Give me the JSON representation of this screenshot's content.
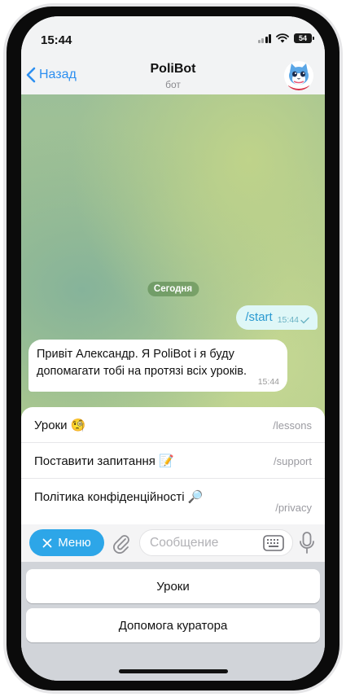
{
  "status_bar": {
    "time": "15:44",
    "battery": "54",
    "icons": [
      "signal-icon",
      "wifi-icon",
      "battery-icon"
    ]
  },
  "header": {
    "back_label": "Назад",
    "title": "PoliBot",
    "subtitle": "бот",
    "avatar_icon": "cat-avatar-icon"
  },
  "chat": {
    "date_chip": "Сегодня",
    "messages": [
      {
        "direction": "out",
        "text": "/start",
        "time": "15:44",
        "status": "read-check-icon"
      },
      {
        "direction": "in",
        "text": "Привіт  Александр. Я PoliBot і я буду допомагати тобі на протязі всіх уроків.",
        "time": "15:44"
      }
    ]
  },
  "commands": [
    {
      "name": "Уроки 🧐",
      "path": "/lessons"
    },
    {
      "name": "Поставити запитання 📝",
      "path": "/support"
    },
    {
      "name": "Політика конфіденційності 🔎",
      "path": "/privacy"
    }
  ],
  "input_bar": {
    "menu_label": "Меню",
    "placeholder": "Сообщение",
    "icons": [
      "close-icon",
      "paperclip-icon",
      "keyboard-icon",
      "microphone-icon"
    ]
  },
  "reply_keyboard": {
    "buttons": [
      "Уроки",
      "Допомога куратора"
    ]
  },
  "colors": {
    "accent": "#2da6e8",
    "link": "#2d8ff0",
    "outgoing_bubble": "#dff7f7"
  }
}
